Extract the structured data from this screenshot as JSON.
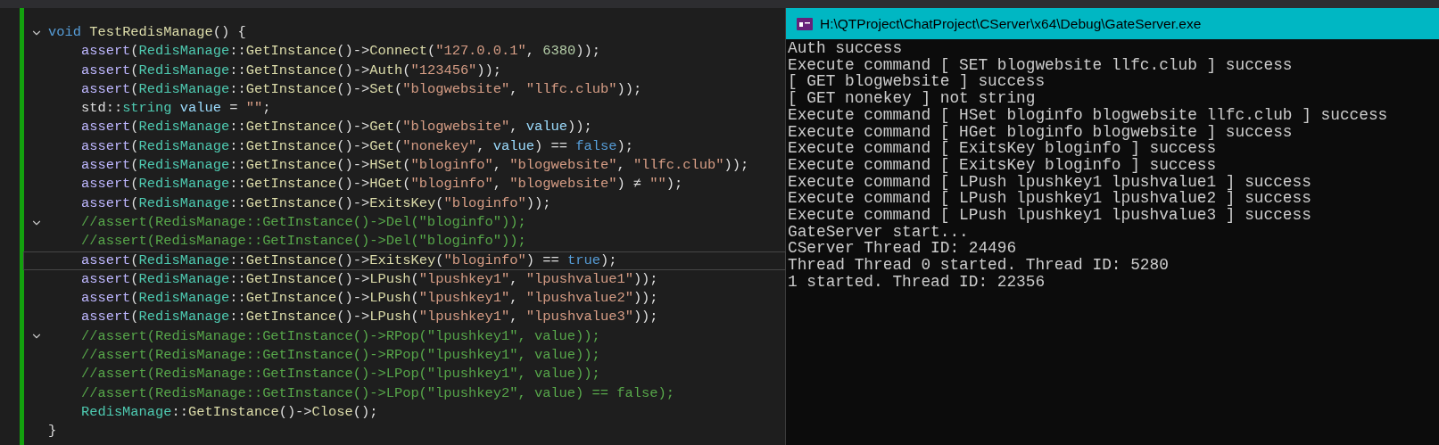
{
  "editor": {
    "lines": [
      {
        "fold": true,
        "current": false,
        "tokens": [
          {
            "kind": "kw",
            "text": "void "
          },
          {
            "kind": "fn",
            "text": "TestRedisManage"
          },
          {
            "kind": "plain",
            "text": "() {"
          }
        ]
      },
      {
        "fold": false,
        "current": false,
        "tokens": [
          {
            "kind": "macro",
            "text": "    assert"
          },
          {
            "kind": "plain",
            "text": "("
          },
          {
            "kind": "type",
            "text": "RedisManage"
          },
          {
            "kind": "plain",
            "text": "::"
          },
          {
            "kind": "fn",
            "text": "GetInstance"
          },
          {
            "kind": "plain",
            "text": "()->"
          },
          {
            "kind": "fn",
            "text": "Connect"
          },
          {
            "kind": "plain",
            "text": "("
          },
          {
            "kind": "str",
            "text": "\"127.0.0.1\""
          },
          {
            "kind": "plain",
            "text": ", "
          },
          {
            "kind": "num",
            "text": "6380"
          },
          {
            "kind": "plain",
            "text": "));"
          }
        ]
      },
      {
        "fold": false,
        "current": false,
        "tokens": [
          {
            "kind": "macro",
            "text": "    assert"
          },
          {
            "kind": "plain",
            "text": "("
          },
          {
            "kind": "type",
            "text": "RedisManage"
          },
          {
            "kind": "plain",
            "text": "::"
          },
          {
            "kind": "fn",
            "text": "GetInstance"
          },
          {
            "kind": "plain",
            "text": "()->"
          },
          {
            "kind": "fn",
            "text": "Auth"
          },
          {
            "kind": "plain",
            "text": "("
          },
          {
            "kind": "str",
            "text": "\"123456\""
          },
          {
            "kind": "plain",
            "text": "));"
          }
        ]
      },
      {
        "fold": false,
        "current": false,
        "tokens": [
          {
            "kind": "macro",
            "text": "    assert"
          },
          {
            "kind": "plain",
            "text": "("
          },
          {
            "kind": "type",
            "text": "RedisManage"
          },
          {
            "kind": "plain",
            "text": "::"
          },
          {
            "kind": "fn",
            "text": "GetInstance"
          },
          {
            "kind": "plain",
            "text": "()->"
          },
          {
            "kind": "fn",
            "text": "Set"
          },
          {
            "kind": "plain",
            "text": "("
          },
          {
            "kind": "str",
            "text": "\"blogwebsite\""
          },
          {
            "kind": "plain",
            "text": ", "
          },
          {
            "kind": "str",
            "text": "\"llfc.club\""
          },
          {
            "kind": "plain",
            "text": "));"
          }
        ]
      },
      {
        "fold": false,
        "current": false,
        "tokens": [
          {
            "kind": "plain",
            "text": "    std::"
          },
          {
            "kind": "type",
            "text": "string"
          },
          {
            "kind": "var",
            "text": " value"
          },
          {
            "kind": "plain",
            "text": " = "
          },
          {
            "kind": "str",
            "text": "\"\""
          },
          {
            "kind": "plain",
            "text": ";"
          }
        ]
      },
      {
        "fold": false,
        "current": false,
        "tokens": [
          {
            "kind": "macro",
            "text": "    assert"
          },
          {
            "kind": "plain",
            "text": "("
          },
          {
            "kind": "type",
            "text": "RedisManage"
          },
          {
            "kind": "plain",
            "text": "::"
          },
          {
            "kind": "fn",
            "text": "GetInstance"
          },
          {
            "kind": "plain",
            "text": "()->"
          },
          {
            "kind": "fn",
            "text": "Get"
          },
          {
            "kind": "plain",
            "text": "("
          },
          {
            "kind": "str",
            "text": "\"blogwebsite\""
          },
          {
            "kind": "plain",
            "text": ", "
          },
          {
            "kind": "var",
            "text": "value"
          },
          {
            "kind": "plain",
            "text": "));"
          }
        ]
      },
      {
        "fold": false,
        "current": false,
        "tokens": [
          {
            "kind": "macro",
            "text": "    assert"
          },
          {
            "kind": "plain",
            "text": "("
          },
          {
            "kind": "type",
            "text": "RedisManage"
          },
          {
            "kind": "plain",
            "text": "::"
          },
          {
            "kind": "fn",
            "text": "GetInstance"
          },
          {
            "kind": "plain",
            "text": "()->"
          },
          {
            "kind": "fn",
            "text": "Get"
          },
          {
            "kind": "plain",
            "text": "("
          },
          {
            "kind": "str",
            "text": "\"nonekey\""
          },
          {
            "kind": "plain",
            "text": ", "
          },
          {
            "kind": "var",
            "text": "value"
          },
          {
            "kind": "plain",
            "text": ") == "
          },
          {
            "kind": "kw",
            "text": "false"
          },
          {
            "kind": "plain",
            "text": ");"
          }
        ]
      },
      {
        "fold": false,
        "current": false,
        "tokens": [
          {
            "kind": "macro",
            "text": "    assert"
          },
          {
            "kind": "plain",
            "text": "("
          },
          {
            "kind": "type",
            "text": "RedisManage"
          },
          {
            "kind": "plain",
            "text": "::"
          },
          {
            "kind": "fn",
            "text": "GetInstance"
          },
          {
            "kind": "plain",
            "text": "()->"
          },
          {
            "kind": "fn",
            "text": "HSet"
          },
          {
            "kind": "plain",
            "text": "("
          },
          {
            "kind": "str",
            "text": "\"bloginfo\""
          },
          {
            "kind": "plain",
            "text": ", "
          },
          {
            "kind": "str",
            "text": "\"blogwebsite\""
          },
          {
            "kind": "plain",
            "text": ", "
          },
          {
            "kind": "str",
            "text": "\"llfc.club\""
          },
          {
            "kind": "plain",
            "text": "));"
          }
        ]
      },
      {
        "fold": false,
        "current": false,
        "tokens": [
          {
            "kind": "macro",
            "text": "    assert"
          },
          {
            "kind": "plain",
            "text": "("
          },
          {
            "kind": "type",
            "text": "RedisManage"
          },
          {
            "kind": "plain",
            "text": "::"
          },
          {
            "kind": "fn",
            "text": "GetInstance"
          },
          {
            "kind": "plain",
            "text": "()->"
          },
          {
            "kind": "fn",
            "text": "HGet"
          },
          {
            "kind": "plain",
            "text": "("
          },
          {
            "kind": "str",
            "text": "\"bloginfo\""
          },
          {
            "kind": "plain",
            "text": ", "
          },
          {
            "kind": "str",
            "text": "\"blogwebsite\""
          },
          {
            "kind": "plain",
            "text": ") ≠ "
          },
          {
            "kind": "str",
            "text": "\"\""
          },
          {
            "kind": "plain",
            "text": ");"
          }
        ]
      },
      {
        "fold": false,
        "current": false,
        "tokens": [
          {
            "kind": "macro",
            "text": "    assert"
          },
          {
            "kind": "plain",
            "text": "("
          },
          {
            "kind": "type",
            "text": "RedisManage"
          },
          {
            "kind": "plain",
            "text": "::"
          },
          {
            "kind": "fn",
            "text": "GetInstance"
          },
          {
            "kind": "plain",
            "text": "()->"
          },
          {
            "kind": "fn",
            "text": "ExitsKey"
          },
          {
            "kind": "plain",
            "text": "("
          },
          {
            "kind": "str",
            "text": "\"bloginfo\""
          },
          {
            "kind": "plain",
            "text": "));"
          }
        ]
      },
      {
        "fold": true,
        "current": false,
        "tokens": [
          {
            "kind": "comment",
            "text": "    //assert(RedisManage::GetInstance()->Del(\"bloginfo\"));"
          }
        ]
      },
      {
        "fold": false,
        "current": false,
        "tokens": [
          {
            "kind": "comment",
            "text": "    //assert(RedisManage::GetInstance()->Del(\"bloginfo\"));"
          }
        ]
      },
      {
        "fold": false,
        "current": true,
        "tokens": [
          {
            "kind": "macro",
            "text": "    assert"
          },
          {
            "kind": "plain",
            "text": "("
          },
          {
            "kind": "type",
            "text": "RedisManage"
          },
          {
            "kind": "plain",
            "text": "::"
          },
          {
            "kind": "fn",
            "text": "GetInstance"
          },
          {
            "kind": "plain",
            "text": "()->"
          },
          {
            "kind": "fn",
            "text": "ExitsKey"
          },
          {
            "kind": "plain",
            "text": "("
          },
          {
            "kind": "str",
            "text": "\"bloginfo\""
          },
          {
            "kind": "plain",
            "text": ") == "
          },
          {
            "kind": "kw",
            "text": "true"
          },
          {
            "kind": "plain",
            "text": ");"
          }
        ]
      },
      {
        "fold": false,
        "current": false,
        "tokens": [
          {
            "kind": "macro",
            "text": "    assert"
          },
          {
            "kind": "plain",
            "text": "("
          },
          {
            "kind": "type",
            "text": "RedisManage"
          },
          {
            "kind": "plain",
            "text": "::"
          },
          {
            "kind": "fn",
            "text": "GetInstance"
          },
          {
            "kind": "plain",
            "text": "()->"
          },
          {
            "kind": "fn",
            "text": "LPush"
          },
          {
            "kind": "plain",
            "text": "("
          },
          {
            "kind": "str",
            "text": "\"lpushkey1\""
          },
          {
            "kind": "plain",
            "text": ", "
          },
          {
            "kind": "str",
            "text": "\"lpushvalue1\""
          },
          {
            "kind": "plain",
            "text": "));"
          }
        ]
      },
      {
        "fold": false,
        "current": false,
        "tokens": [
          {
            "kind": "macro",
            "text": "    assert"
          },
          {
            "kind": "plain",
            "text": "("
          },
          {
            "kind": "type",
            "text": "RedisManage"
          },
          {
            "kind": "plain",
            "text": "::"
          },
          {
            "kind": "fn",
            "text": "GetInstance"
          },
          {
            "kind": "plain",
            "text": "()->"
          },
          {
            "kind": "fn",
            "text": "LPush"
          },
          {
            "kind": "plain",
            "text": "("
          },
          {
            "kind": "str",
            "text": "\"lpushkey1\""
          },
          {
            "kind": "plain",
            "text": ", "
          },
          {
            "kind": "str",
            "text": "\"lpushvalue2\""
          },
          {
            "kind": "plain",
            "text": "));"
          }
        ]
      },
      {
        "fold": false,
        "current": false,
        "tokens": [
          {
            "kind": "macro",
            "text": "    assert"
          },
          {
            "kind": "plain",
            "text": "("
          },
          {
            "kind": "type",
            "text": "RedisManage"
          },
          {
            "kind": "plain",
            "text": "::"
          },
          {
            "kind": "fn",
            "text": "GetInstance"
          },
          {
            "kind": "plain",
            "text": "()->"
          },
          {
            "kind": "fn",
            "text": "LPush"
          },
          {
            "kind": "plain",
            "text": "("
          },
          {
            "kind": "str",
            "text": "\"lpushkey1\""
          },
          {
            "kind": "plain",
            "text": ", "
          },
          {
            "kind": "str",
            "text": "\"lpushvalue3\""
          },
          {
            "kind": "plain",
            "text": "));"
          }
        ]
      },
      {
        "fold": true,
        "current": false,
        "tokens": [
          {
            "kind": "comment",
            "text": "    //assert(RedisManage::GetInstance()->RPop(\"lpushkey1\", value));"
          }
        ]
      },
      {
        "fold": false,
        "current": false,
        "tokens": [
          {
            "kind": "comment",
            "text": "    //assert(RedisManage::GetInstance()->RPop(\"lpushkey1\", value));"
          }
        ]
      },
      {
        "fold": false,
        "current": false,
        "tokens": [
          {
            "kind": "comment",
            "text": "    //assert(RedisManage::GetInstance()->LPop(\"lpushkey1\", value));"
          }
        ]
      },
      {
        "fold": false,
        "current": false,
        "tokens": [
          {
            "kind": "comment",
            "text": "    //assert(RedisManage::GetInstance()->LPop(\"lpushkey2\", value) == false);"
          }
        ]
      },
      {
        "fold": false,
        "current": false,
        "tokens": [
          {
            "kind": "type",
            "text": "    RedisManage"
          },
          {
            "kind": "plain",
            "text": "::"
          },
          {
            "kind": "fn",
            "text": "GetInstance"
          },
          {
            "kind": "plain",
            "text": "()->"
          },
          {
            "kind": "fn",
            "text": "Close"
          },
          {
            "kind": "plain",
            "text": "();"
          }
        ]
      },
      {
        "fold": false,
        "current": false,
        "tokens": [
          {
            "kind": "plain",
            "text": "}"
          }
        ]
      }
    ]
  },
  "console": {
    "title": "H:\\QTProject\\ChatProject\\CServer\\x64\\Debug\\GateServer.exe",
    "lines": [
      "Auth success",
      "Execute command [ SET blogwebsite llfc.club ] success",
      "[ GET blogwebsite ] success",
      "[ GET nonekey ] not string",
      "Execute command [ HSet bloginfo blogwebsite llfc.club ] success",
      "Execute command [ HGet bloginfo blogwebsite ] success",
      "Execute command [ ExitsKey bloginfo ] success",
      "Execute command [ ExitsKey bloginfo ] success",
      "Execute command [ LPush lpushkey1 lpushvalue1 ] success",
      "Execute command [ LPush lpushkey1 lpushvalue2 ] success",
      "Execute command [ LPush lpushkey1 lpushvalue3 ] success",
      "GateServer start...",
      "CServer Thread ID: 24496",
      "Thread Thread 0 started. Thread ID: 5280",
      "1 started. Thread ID: 22356"
    ]
  }
}
